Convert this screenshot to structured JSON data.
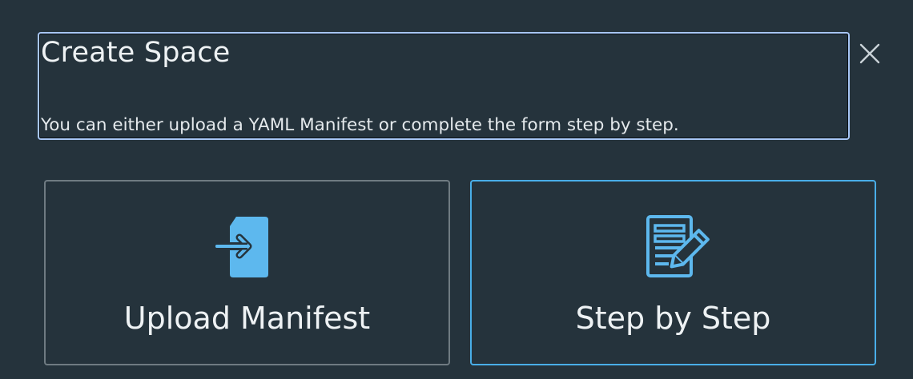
{
  "dialog": {
    "title": "Create Space",
    "subtitle": "You can either upload a YAML Manifest or complete the form step by step."
  },
  "options": [
    {
      "label": "Upload Manifest",
      "icon": "upload-file-icon"
    },
    {
      "label": "Step by Step",
      "icon": "form-edit-icon"
    }
  ],
  "colors": {
    "background": "#25333c",
    "accent": "#49aee8",
    "focus_outline": "#a7c6f5",
    "border": "#6f7b82"
  },
  "close_icon": "close-icon"
}
